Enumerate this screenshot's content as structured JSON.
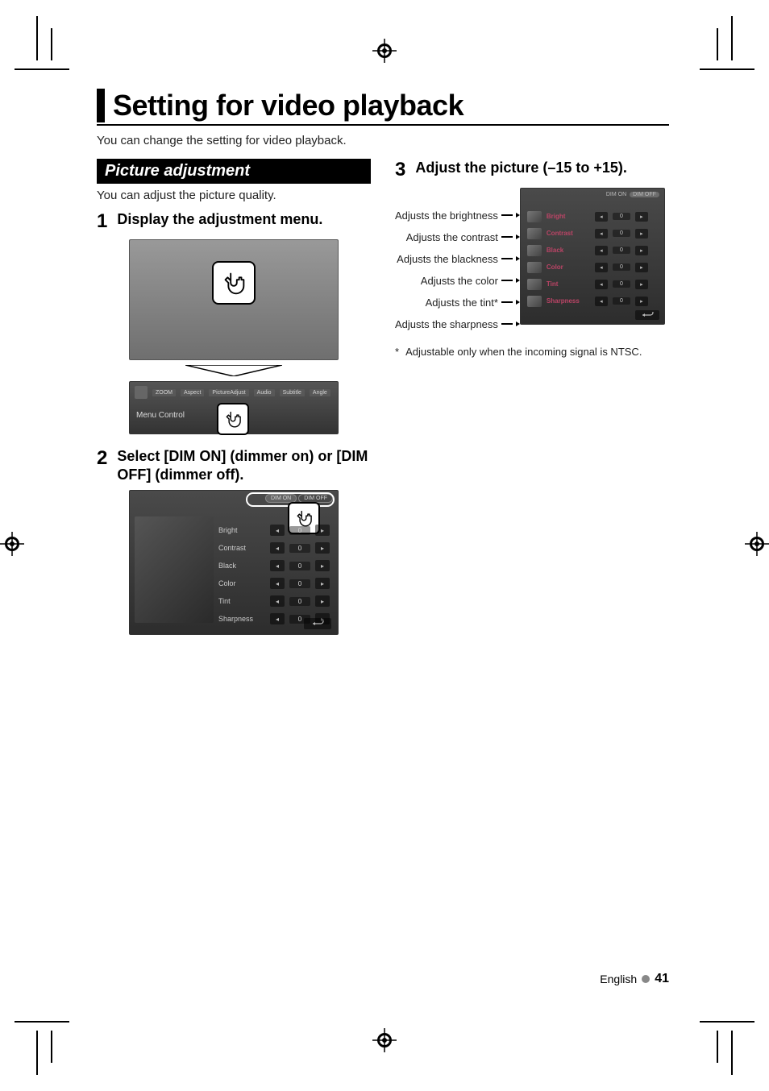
{
  "title": "Setting for video playback",
  "intro": "You can change the setting for video playback.",
  "left": {
    "subhead": "Picture adjustment",
    "sub_intro": "You can adjust the picture quality.",
    "step1": {
      "num": "1",
      "title": "Display the adjustment menu."
    },
    "menubar": {
      "items": [
        "ZOOM",
        "Aspect",
        "PictureAdjust",
        "Audio",
        "Subtitle",
        "Angle"
      ],
      "label": "Menu Control"
    },
    "step2": {
      "num": "2",
      "title": "Select [DIM ON] (dimmer on) or [DIM OFF] (dimmer off)."
    },
    "settings": {
      "tab_on": "DIM ON",
      "tab_off": "DIM OFF",
      "rows": [
        {
          "label": "Bright",
          "val": "0"
        },
        {
          "label": "Contrast",
          "val": "0"
        },
        {
          "label": "Black",
          "val": "0"
        },
        {
          "label": "Color",
          "val": "0"
        },
        {
          "label": "Tint",
          "val": "0"
        },
        {
          "label": "Sharpness",
          "val": "0"
        }
      ]
    }
  },
  "right": {
    "step3": {
      "num": "3",
      "title": "Adjust the picture (–15 to +15)."
    },
    "labels": [
      "Adjusts the brightness",
      "Adjusts the contrast",
      "Adjusts the blackness",
      "Adjusts the color",
      "Adjusts the tint*",
      "Adjusts the sharpness"
    ],
    "panel": {
      "tab_on": "DIM ON",
      "tab_off": "DIM OFF",
      "rows": [
        {
          "label": "Bright",
          "val": "0"
        },
        {
          "label": "Contrast",
          "val": "0"
        },
        {
          "label": "Black",
          "val": "0"
        },
        {
          "label": "Color",
          "val": "0"
        },
        {
          "label": "Tint",
          "val": "0"
        },
        {
          "label": "Sharpness",
          "val": "0"
        }
      ]
    },
    "footnote_mark": "*",
    "footnote": "Adjustable only when the incoming signal is NTSC."
  },
  "footer": {
    "lang": "English",
    "page": "41"
  }
}
